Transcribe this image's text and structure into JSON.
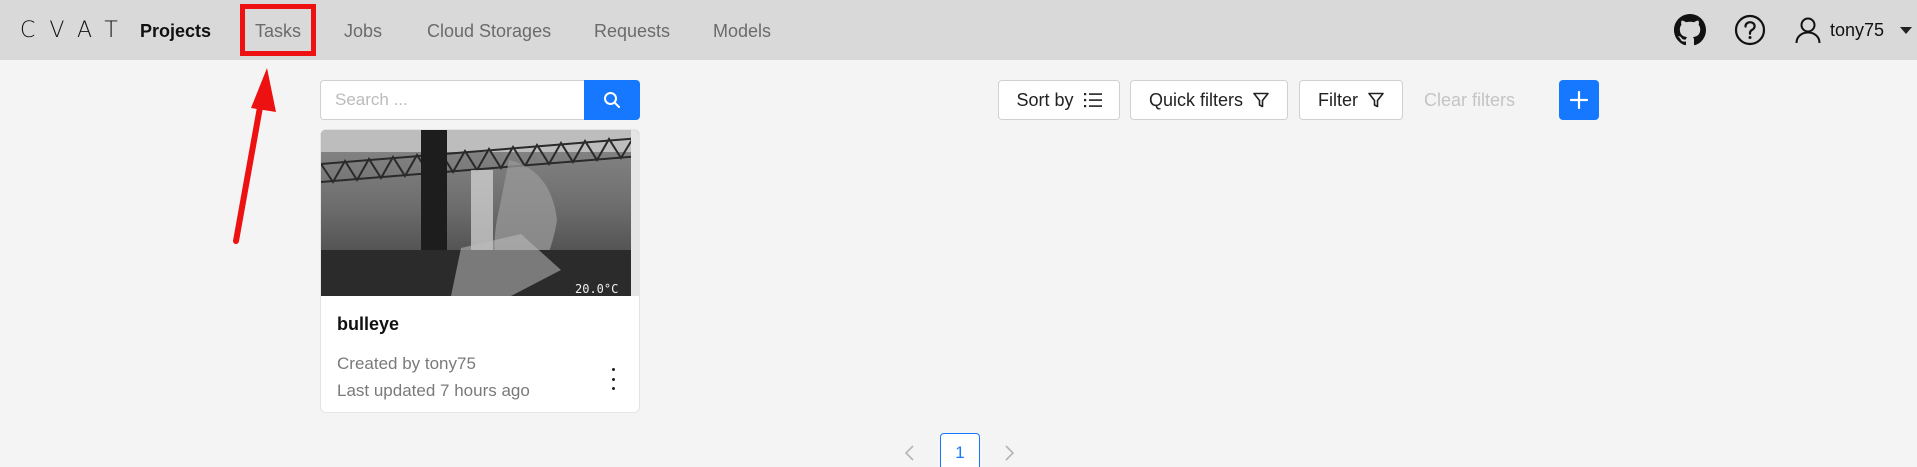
{
  "logo": {
    "text": "CVAT"
  },
  "nav": {
    "projects": "Projects",
    "tasks": "Tasks",
    "jobs": "Jobs",
    "cloud_storages": "Cloud Storages",
    "requests": "Requests",
    "models": "Models"
  },
  "header": {
    "username": "tony75",
    "icons": [
      "github-icon",
      "help-icon",
      "user-icon",
      "caret-down-icon"
    ]
  },
  "toolbar": {
    "search_placeholder": "Search ...",
    "sort_label": "Sort by",
    "quick_filters_label": "Quick filters",
    "filter_label": "Filter",
    "clear_filters_label": "Clear filters"
  },
  "projects": [
    {
      "name": "bulleye",
      "created_by": "Created by tony75",
      "updated": "Last updated 7 hours ago",
      "preview_overlay": "20.0°C"
    }
  ],
  "pagination": {
    "current_page": "1",
    "prev": "<",
    "next": ">"
  },
  "colors": {
    "accent": "#1677ff",
    "navbar": "#d9d9d9",
    "background": "#f4f4f4",
    "highlight": "#ee1111"
  }
}
